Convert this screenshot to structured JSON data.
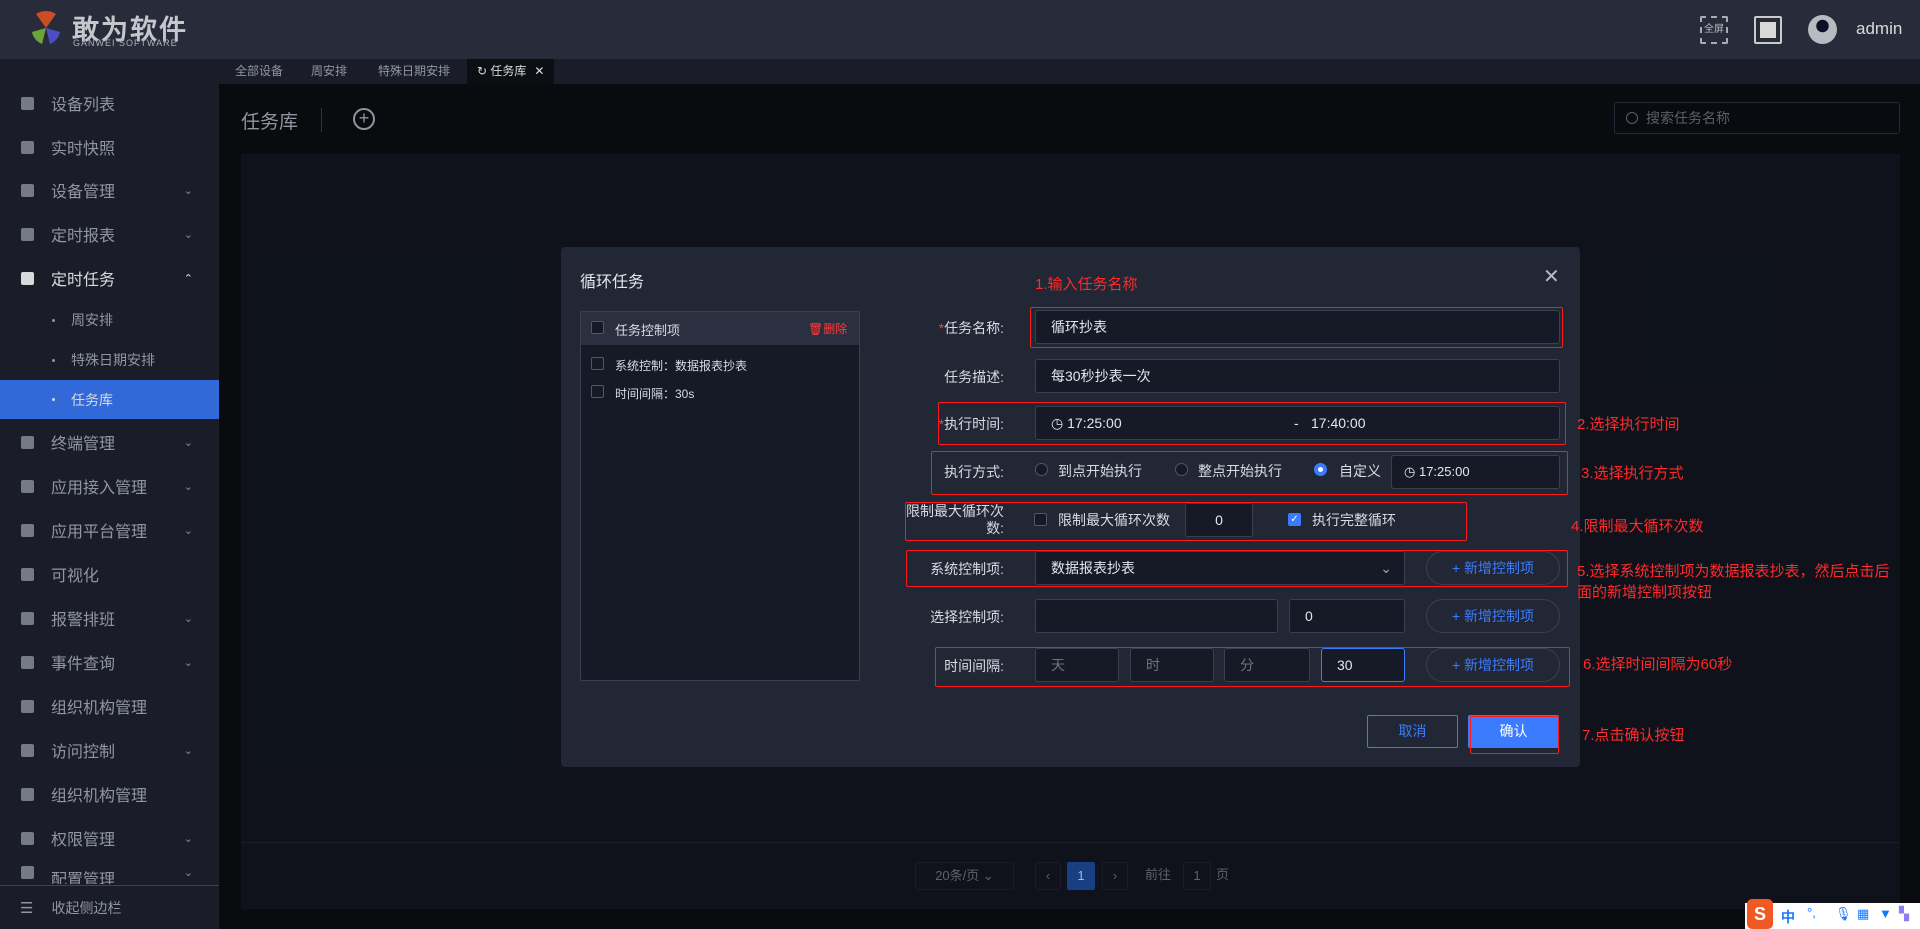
{
  "header": {
    "brand": "敢为软件",
    "brand_sub": "GANWEI SOFTWARE",
    "fullscreen_label": "全屏",
    "user": "admin"
  },
  "sidebar": {
    "items": [
      {
        "label": "设备列表",
        "chevron": false
      },
      {
        "label": "实时快照",
        "chevron": false
      },
      {
        "label": "设备管理",
        "chevron": true
      },
      {
        "label": "定时报表",
        "chevron": true
      },
      {
        "label": "定时任务",
        "chevron": true,
        "expanded": true
      }
    ],
    "subitems": [
      {
        "label": "周安排"
      },
      {
        "label": "特殊日期安排"
      },
      {
        "label": "任务库",
        "active": true
      }
    ],
    "items2": [
      {
        "label": "终端管理",
        "chevron": true
      },
      {
        "label": "应用接入管理",
        "chevron": true
      },
      {
        "label": "应用平台管理",
        "chevron": true
      },
      {
        "label": "可视化",
        "chevron": false
      },
      {
        "label": "报警排班",
        "chevron": true
      },
      {
        "label": "事件查询",
        "chevron": true
      },
      {
        "label": "组织机构管理",
        "chevron": false
      },
      {
        "label": "访问控制",
        "chevron": true
      },
      {
        "label": "组织机构管理",
        "chevron": false
      },
      {
        "label": "权限管理",
        "chevron": true
      },
      {
        "label": "配置管理",
        "chevron": true
      }
    ],
    "collapse": "收起侧边栏"
  },
  "tabs": [
    "全部设备",
    "周安排",
    "特殊日期安排",
    "任务库"
  ],
  "page": {
    "title": "任务库",
    "search_placeholder": "搜索任务名称"
  },
  "pagination": {
    "page_size": "20条/页",
    "current": "1",
    "goto_label": "前往",
    "goto_value": "1",
    "page_suffix": "页"
  },
  "modal": {
    "title": "循环任务",
    "left_panel": {
      "header": "任务控制项",
      "delete": "删除",
      "items": [
        "系统控制：数据报表抄表",
        "时间间隔：30s"
      ]
    },
    "form": {
      "name_label": "任务名称:",
      "name_value": "循环抄表",
      "desc_label": "任务描述:",
      "desc_value": "每30秒抄表一次",
      "time_label": "执行时间:",
      "time_start": "17:25:00",
      "time_sep": "-",
      "time_end": "17:40:00",
      "mode_label": "执行方式:",
      "mode_options": [
        "到点开始执行",
        "整点开始执行",
        "自定义"
      ],
      "mode_selected": "自定义",
      "mode_time": "17:25:00",
      "max_label": "限制最大循环次数:",
      "max_checkbox": "限制最大循环次数",
      "max_checked": false,
      "max_value": "0",
      "full_cycle": "执行完整循环",
      "full_cycle_checked": true,
      "sys_label": "系统控制项:",
      "sys_value": "数据报表抄表",
      "sel_label": "选择控制项:",
      "sel_value": "",
      "sel_number": "0",
      "interval_label": "时间间隔:",
      "interval_placeholders": [
        "天",
        "时",
        "分"
      ],
      "interval_seconds": "30",
      "add_btn": "+ 新增控制项"
    },
    "cancel": "取消",
    "confirm": "确认"
  },
  "annotations": [
    "1.输入任务名称",
    "2.选择执行时间",
    "3.选择执行方式",
    "4.限制最大循环次数",
    "5.选择系统控制项为数据报表抄表，然后点击后",
    "面的新增控制项按钮",
    "6.选择时间间隔为60秒",
    "7.点击确认按钮"
  ],
  "ime": {
    "label": "中"
  }
}
